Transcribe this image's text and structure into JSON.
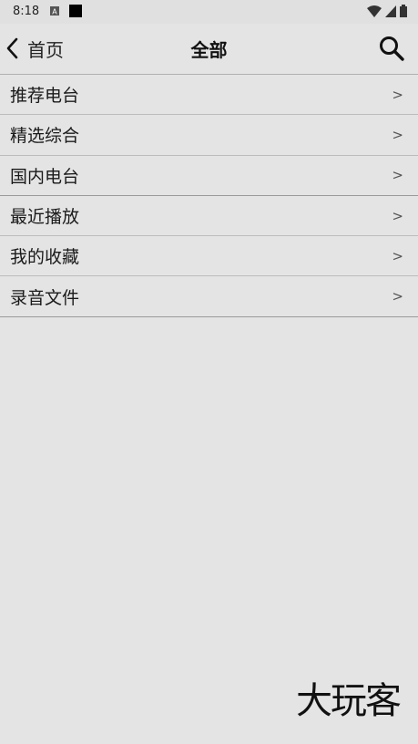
{
  "status_bar": {
    "time": "8:18",
    "icons": [
      "notification-a-icon",
      "square-icon",
      "wifi-icon",
      "signal-icon",
      "battery-icon"
    ]
  },
  "header": {
    "back_label": "首页",
    "title": "全部",
    "search_icon": "search-icon"
  },
  "menu": {
    "arrow": ">",
    "items": [
      {
        "label": "推荐电台"
      },
      {
        "label": "精选综合"
      },
      {
        "label": "国内电台"
      },
      {
        "label": "最近播放"
      },
      {
        "label": "我的收藏"
      },
      {
        "label": "录音文件"
      }
    ]
  },
  "watermark": "大玩客",
  "colors": {
    "background": "#e4e4e4",
    "text": "#1a1a1a",
    "divider": "#bcbcbc"
  }
}
